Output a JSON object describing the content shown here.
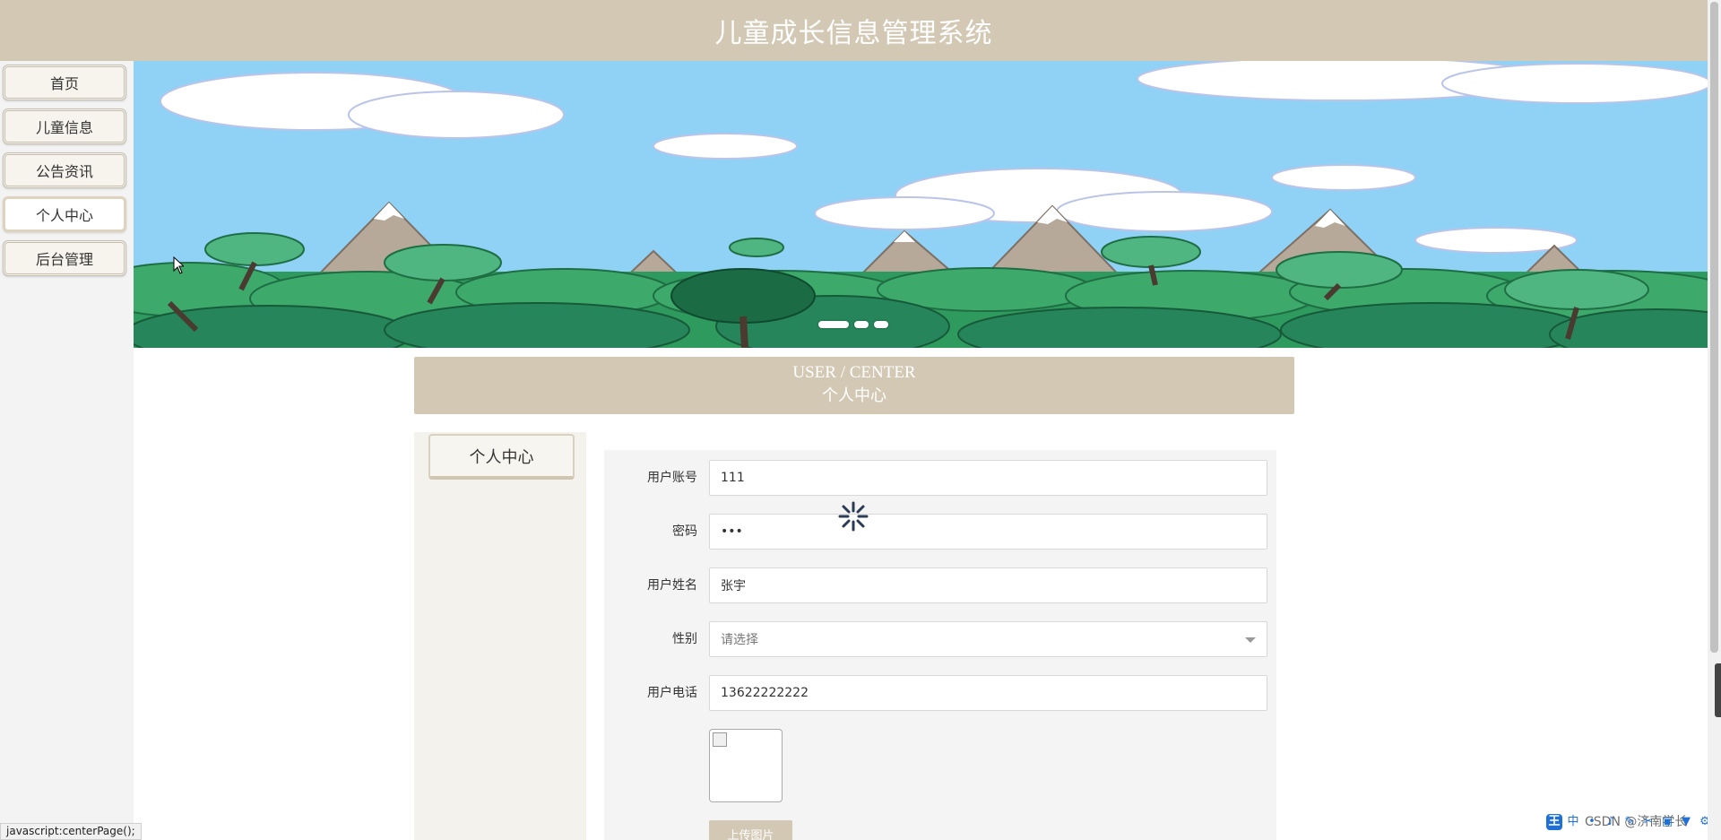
{
  "header": {
    "title": "儿童成长信息管理系统"
  },
  "sidebar": {
    "items": [
      {
        "label": "首页"
      },
      {
        "label": "儿童信息"
      },
      {
        "label": "公告资讯"
      },
      {
        "label": "个人中心"
      },
      {
        "label": "后台管理"
      }
    ],
    "active_index": 3
  },
  "banner": {
    "slide_count": 3,
    "active_slide": 1
  },
  "section": {
    "title_en": "USER / CENTER",
    "title_cn": "个人中心"
  },
  "left_panel": {
    "tab_label": "个人中心"
  },
  "form": {
    "account": {
      "label": "用户账号",
      "value": "111"
    },
    "password": {
      "label": "密码",
      "value": "•••"
    },
    "name": {
      "label": "用户姓名",
      "value": "张宇"
    },
    "gender": {
      "label": "性别",
      "placeholder": "请选择"
    },
    "phone": {
      "label": "用户电话",
      "value": "13622222222"
    },
    "upload_label": "上传图片"
  },
  "status_bar": {
    "text": "javascript:centerPage();"
  },
  "watermark": {
    "text": "CSDN @济南学长"
  },
  "tray": {
    "main_icon": "王",
    "ime_mode": "中"
  },
  "colors": {
    "theme": "#d3c8b4",
    "sky": "#8fd2f6",
    "forest": "#2f9a5e"
  }
}
